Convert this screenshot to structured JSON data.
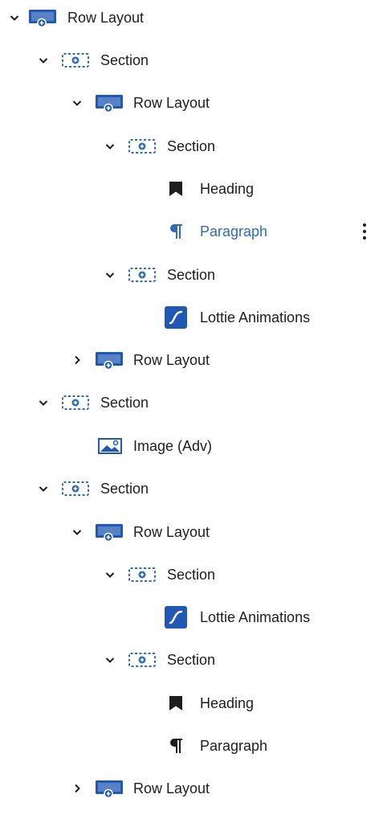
{
  "tree": {
    "items": [
      {
        "label": "Row Layout",
        "icon": "row-layout-icon",
        "expander": "expanded"
      },
      {
        "label": "Section",
        "icon": "section-icon",
        "expander": "expanded"
      },
      {
        "label": "Row Layout",
        "icon": "row-layout-icon",
        "expander": "expanded"
      },
      {
        "label": "Section",
        "icon": "section-icon",
        "expander": "expanded"
      },
      {
        "label": "Heading",
        "icon": "heading-bookmark-icon",
        "expander": "none"
      },
      {
        "label": "Paragraph",
        "icon": "paragraph-icon",
        "expander": "none",
        "selected": true,
        "options": "more-options-icon"
      },
      {
        "label": "Section",
        "icon": "section-icon",
        "expander": "expanded"
      },
      {
        "label": "Lottie Animations",
        "icon": "lottie-icon",
        "expander": "none"
      },
      {
        "label": "Row Layout",
        "icon": "row-layout-icon",
        "expander": "collapsed"
      },
      {
        "label": "Section",
        "icon": "section-icon",
        "expander": "expanded"
      },
      {
        "label": "Image (Adv)",
        "icon": "image-icon",
        "expander": "none"
      },
      {
        "label": "Section",
        "icon": "section-icon",
        "expander": "expanded"
      },
      {
        "label": "Row Layout",
        "icon": "row-layout-icon",
        "expander": "expanded"
      },
      {
        "label": "Section",
        "icon": "section-icon",
        "expander": "expanded"
      },
      {
        "label": "Lottie Animations",
        "icon": "lottie-icon",
        "expander": "none"
      },
      {
        "label": "Section",
        "icon": "section-icon",
        "expander": "expanded"
      },
      {
        "label": "Heading",
        "icon": "heading-bookmark-icon",
        "expander": "none"
      },
      {
        "label": "Paragraph",
        "icon": "paragraph-icon",
        "expander": "none"
      },
      {
        "label": "Row Layout",
        "icon": "row-layout-icon",
        "expander": "collapsed"
      }
    ]
  },
  "colors": {
    "text": "#1e1e1e",
    "selected": "#2f6cb5",
    "block_blue": "#2058b3",
    "section_blue": "#2f6cb5"
  }
}
